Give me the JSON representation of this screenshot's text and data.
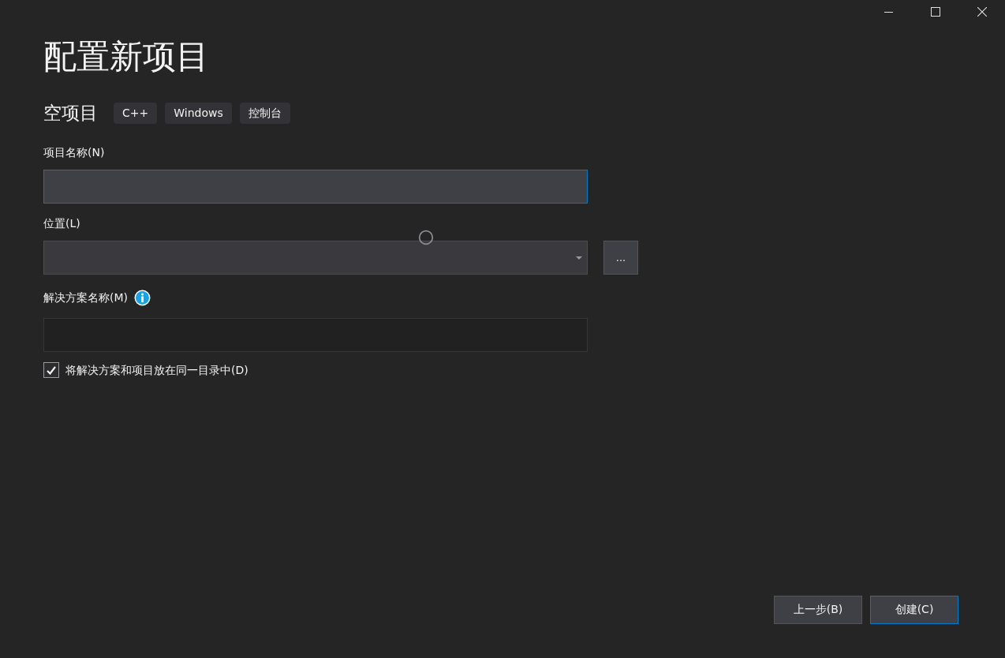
{
  "title": "配置新项目",
  "template": {
    "name": "空项目",
    "tags": [
      "C++",
      "Windows",
      "控制台"
    ]
  },
  "fields": [
    {
      "kind": "text",
      "label": "项目名称(N)",
      "focused": true,
      "disabled": false
    },
    {
      "kind": "dropdown",
      "label": "位置(L)",
      "focused": false,
      "disabled": false,
      "browse_label": "..."
    },
    {
      "kind": "text",
      "label": "解决方案名称(M)",
      "focused": false,
      "disabled": true,
      "info": true
    }
  ],
  "checkbox": {
    "label": "将解决方案和项目放在同一目录中(D)",
    "checked": true
  },
  "buttons": [
    {
      "label": "上一步(B)",
      "default": false
    },
    {
      "label": "创建(C)",
      "default": true
    }
  ]
}
